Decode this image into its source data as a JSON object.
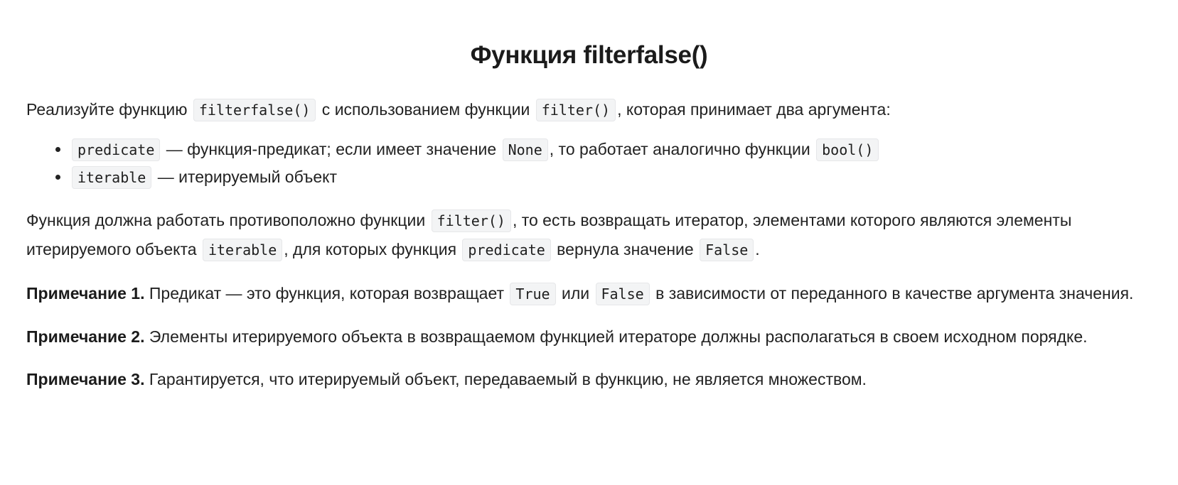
{
  "title": "Функция filterfalse()",
  "intro": {
    "t1": "Реализуйте функцию ",
    "code1": "filterfalse()",
    "t2": " с использованием функции ",
    "code2": "filter()",
    "t3": ", которая принимает два аргумента:"
  },
  "args": [
    {
      "code": "predicate",
      "t1": " — функция-предикат; если имеет значение ",
      "code2": "None",
      "t2": ", то работает аналогично функции ",
      "code3": "bool()"
    },
    {
      "code": "iterable",
      "t1": " — итерируемый объект"
    }
  ],
  "description": {
    "t1": "Функция должна работать противоположно функции ",
    "code1": "filter()",
    "t2": ", то есть возвращать итератор, элементами которого являются элементы итерируемого объекта ",
    "code2": "iterable",
    "t3": ", для которых функция ",
    "code3": "predicate",
    "t4": " вернула значение ",
    "code4": "False",
    "t5": "."
  },
  "notes": [
    {
      "label": "Примечание 1.",
      "t1": " Предикат — это функция, которая возвращает ",
      "code1": "True",
      "t2": " или ",
      "code2": "False",
      "t3": " в зависимости от переданного в качестве аргумента значения."
    },
    {
      "label": "Примечание 2.",
      "t1": " Элементы итерируемого объекта в возвращаемом функцией итераторе должны располагаться в своем исходном порядке."
    },
    {
      "label": "Примечание 3.",
      "t1": " Гарантируется, что итерируемый объект, передаваемый в функцию, не является множеством."
    }
  ]
}
